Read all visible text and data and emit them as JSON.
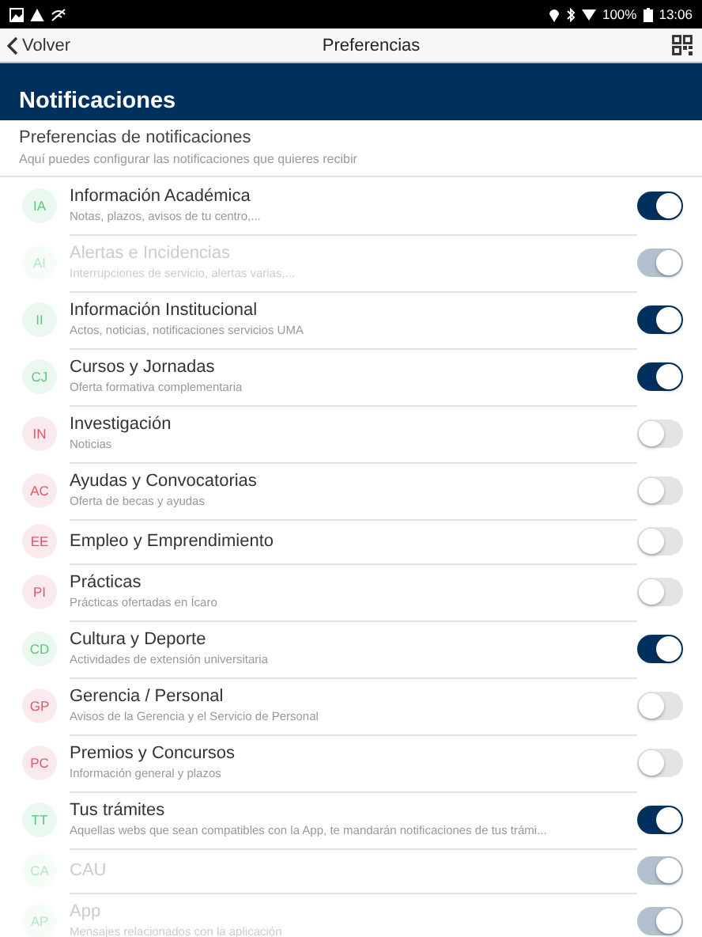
{
  "status_bar": {
    "battery": "100%",
    "time": "13:06"
  },
  "nav": {
    "back": "Volver",
    "title": "Preferencias"
  },
  "banner": {
    "title": "Notificaciones"
  },
  "intro": {
    "title": "Preferencias de notificaciones",
    "subtitle": "Aquí puedes configurar las notificaciones que quieres recibir"
  },
  "items": [
    {
      "badge": "IA",
      "color": "#5cc87a",
      "title": "Información Académica",
      "subtitle": "Notas, plazos, avisos de tu centro,...",
      "on": true,
      "disabled": false
    },
    {
      "badge": "AI",
      "color": "#b4e8c2",
      "title": "Alertas e Incidencias",
      "subtitle": "Interrupciones de servicio, alertas varias,...",
      "on": true,
      "disabled": true
    },
    {
      "badge": "II",
      "color": "#5cc87a",
      "title": "Información Institucional",
      "subtitle": "Actos, noticias, notificaciones servicios UMA",
      "on": true,
      "disabled": false
    },
    {
      "badge": "CJ",
      "color": "#5cc87a",
      "title": "Cursos y Jornadas",
      "subtitle": "Oferta formativa complementaria",
      "on": true,
      "disabled": false
    },
    {
      "badge": "IN",
      "color": "#e0566a",
      "title": "Investigación",
      "subtitle": "Noticias",
      "on": false,
      "disabled": false
    },
    {
      "badge": "AC",
      "color": "#e0566a",
      "title": "Ayudas y Convocatorias",
      "subtitle": "Oferta de becas y ayudas",
      "on": false,
      "disabled": false
    },
    {
      "badge": "EE",
      "color": "#e0566a",
      "title": "Empleo y Emprendimiento",
      "on": false,
      "disabled": false
    },
    {
      "badge": "PI",
      "color": "#e0566a",
      "title": "Prácticas",
      "subtitle": "Prácticas ofertadas en Ícaro",
      "on": false,
      "disabled": false
    },
    {
      "badge": "CD",
      "color": "#5cc87a",
      "title": "Cultura y Deporte",
      "subtitle": "Actividades de extensión universitaria",
      "on": true,
      "disabled": false
    },
    {
      "badge": "GP",
      "color": "#e0566a",
      "title": "Gerencia / Personal",
      "subtitle": "Avisos de la Gerencia y el Servicio de Personal",
      "on": false,
      "disabled": false
    },
    {
      "badge": "PC",
      "color": "#e0566a",
      "title": "Premios y Concursos",
      "subtitle": "Información general y plazos",
      "on": false,
      "disabled": false
    },
    {
      "badge": "TT",
      "color": "#5cc87a",
      "title": "Tus trámites",
      "subtitle": "Aquellas webs que sean compatibles con la App, te mandarán notificaciones de tus trámi...",
      "on": true,
      "disabled": false
    },
    {
      "badge": "CA",
      "color": "#b4e8c2",
      "title": "CAU",
      "on": true,
      "disabled": true
    },
    {
      "badge": "AP",
      "color": "#b4e8c2",
      "title": "App",
      "subtitle": "Mensajes relacionados con la aplicación",
      "on": true,
      "disabled": true
    }
  ]
}
